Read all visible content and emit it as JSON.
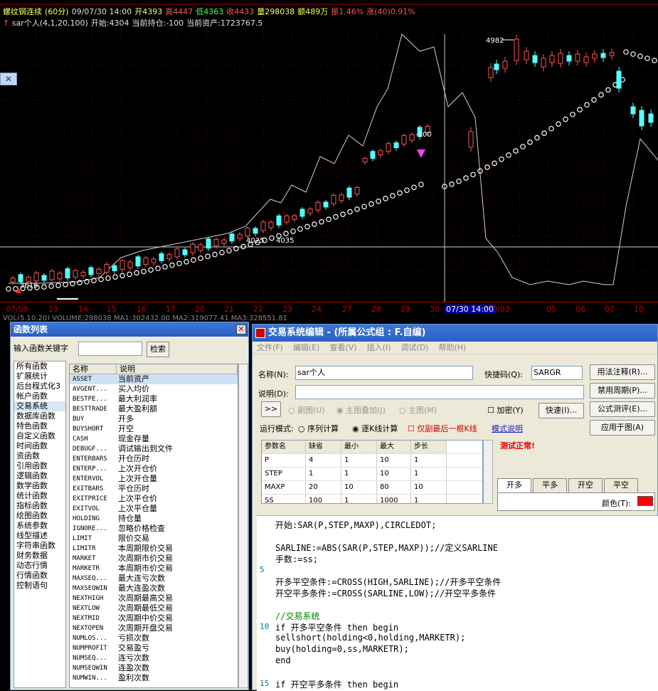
{
  "chart": {
    "symbol": "螺纹钢连续",
    "period": "(60分)",
    "datetime": "09/07/30 14:00",
    "open_label": "开4393",
    "high_label": "高4447",
    "low_label": "低4363",
    "close_label": "收4433",
    "volume_label": "量298038",
    "amount_label": "额489万",
    "amplitude_label": "振1.46%",
    "change_label": "涨(40)0.91%",
    "indicator": "sar个人(4,1,20,100)",
    "ind_start": "开始:4304",
    "ind_hold": "当前持仓:-100",
    "ind_asset": "当前资产:1723767.5",
    "price_peak": "4982",
    "price_mid": "4025",
    "price_mid2": "4035",
    "price_low": "3616",
    "signal_text": "-100",
    "vol_line": "VOL(5,10,20) VOLUME:298038 MA1:302432.00 MA2:319077.41 MA3:328551.81",
    "x_labels": [
      "07/09",
      "13",
      "14",
      "15",
      "16",
      "17",
      "20",
      "21",
      "22",
      "23",
      "24",
      "27",
      "28",
      "29",
      "30",
      "07/30 14:00",
      "0/03",
      "05",
      "06",
      "07",
      "10"
    ],
    "highlight_index": 15
  },
  "fn_window": {
    "title": "函数列表",
    "search_label": "输入函数关键字",
    "search_button": "检索",
    "categories": [
      "所有函数",
      "扩展统计",
      "后台程式化3",
      "帐户函数",
      "交易系统",
      "数据库函数",
      "特色函数",
      "自定义函数",
      "时间函数",
      "资函数",
      "引用函数",
      "逻辑函数",
      "数学函数",
      "统计函数",
      "指标函数",
      "绘图函数",
      "系统参数",
      "线型描述",
      "字符串函数",
      "财务数据",
      "动态行情",
      "行情函数",
      "控制语句"
    ],
    "selected_category": 4,
    "col_name": "名称",
    "col_desc": "说明",
    "functions": [
      [
        "ASSET",
        "当前资产"
      ],
      [
        "AVGENT...",
        "买入均价"
      ],
      [
        "BESTPE...",
        "最大利润率"
      ],
      [
        "BESTTRADE",
        "最大盈利额"
      ],
      [
        "BUY",
        "开多"
      ],
      [
        "BUYSHORT",
        "开空"
      ],
      [
        "CASH",
        "现金存量"
      ],
      [
        "DEBUGF...",
        "调试输出到文件"
      ],
      [
        "ENTERBARS",
        "开仓历时"
      ],
      [
        "ENTERP...",
        "上次开仓价"
      ],
      [
        "ENTERVOL",
        "上次开仓量"
      ],
      [
        "EXITBARS",
        "平仓历时"
      ],
      [
        "EXITPRICE",
        "上次平仓价"
      ],
      [
        "EXITVOL",
        "上次平仓量"
      ],
      [
        "HOLDING",
        "持仓量"
      ],
      [
        "IGNORE...",
        "忽略价格检查"
      ],
      [
        "LIMIT",
        "限价交易"
      ],
      [
        "LIMITR",
        "本周期限价交易"
      ],
      [
        "MARKET",
        "次周期市价交易"
      ],
      [
        "MARKETR",
        "本周期市价交易"
      ],
      [
        "MAXSEQ...",
        "最大连亏次数"
      ],
      [
        "MAXSEQWIN",
        "最大连盈次数"
      ],
      [
        "NEXTHIGH",
        "次周期最高交易"
      ],
      [
        "NEXTLOW",
        "次周期最低交易"
      ],
      [
        "NEXTMID",
        "次周期中价交易"
      ],
      [
        "NEXTOPEN",
        "次周期开盘交易"
      ],
      [
        "NUMLOS...",
        "亏损次数"
      ],
      [
        "NUMPROFIT",
        "交易盈亏"
      ],
      [
        "NUMSEQ...",
        "连亏次数"
      ],
      [
        "NUMSEQWIN",
        "连盈次数"
      ],
      [
        "NUMWIN...",
        "盈利次数"
      ]
    ]
  },
  "editor": {
    "title": "交易系统编辑 - (所属公式组 : F.自编)",
    "menu": [
      "文件(F)",
      "编辑(E)",
      "查看(V)",
      "插入(I)",
      "调试(D)",
      "帮助(H)"
    ],
    "name_label": "名称(N):",
    "name_value": "sar个人",
    "shortcut_label": "快捷码(Q):",
    "shortcut_value": "SARGR",
    "desc_label": "说明(D):",
    "btn_usage": "用法注释(R)...",
    "btn_period": "禁用周期(P)...",
    "btn_test": "公式测评(E)...",
    "btn_apply": "应用于图(A)",
    "btn_arrow": ">>",
    "radio_sub": "副图(U)",
    "radio_main_overlay": "主图叠加(J)",
    "radio_main": "主图(M)",
    "chk_encrypt": "加密(Y)",
    "btn_fast": "快速(I)...",
    "run_mode_label": "运行模式:",
    "opt_seq": "序列计算",
    "opt_tick": "逐K线计算",
    "opt_last": "仅副最后一根K线",
    "mode_help": "模式说明",
    "test_ok": "测试正常!",
    "params_head": [
      "参数名",
      "缺省",
      "最小",
      "最大",
      "步长"
    ],
    "params": [
      [
        "P",
        "4",
        "1",
        "10",
        "1"
      ],
      [
        "STEP",
        "1",
        "1",
        "10",
        "1"
      ],
      [
        "MAXP",
        "20",
        "10",
        "80",
        "10"
      ],
      [
        "SS",
        "100",
        "1",
        "1000",
        "1"
      ]
    ],
    "tabs": [
      "开多",
      "平多",
      "开空",
      "平空"
    ],
    "color_label": "颜色(T):",
    "code_lines": [
      {
        "n": "",
        "t": "开始:SAR(P,STEP,MAXP),CIRCLEDOT;"
      },
      {
        "n": "",
        "t": ""
      },
      {
        "n": "",
        "t": "SARLINE:=ABS(SAR(P,STEP,MAXP));//定义SARLINE"
      },
      {
        "n": "",
        "t": "手数:=ss;"
      },
      {
        "n": "5",
        "t": ""
      },
      {
        "n": "",
        "t": "开多平空条件:=CROSS(HIGH,SARLINE);//开多平空条件"
      },
      {
        "n": "",
        "t": "开空平多条件:=CROSS(SARLINE,LOW);//开空平多条件"
      },
      {
        "n": "",
        "t": ""
      },
      {
        "n": "",
        "t": "//交易系统"
      },
      {
        "n": "10",
        "t": "if 开多平空条件 then begin"
      },
      {
        "n": "",
        "t": "sellshort(holding<0,holding,MARKETR);"
      },
      {
        "n": "",
        "t": "buy(holding=0,ss,MARKETR);"
      },
      {
        "n": "",
        "t": "end"
      },
      {
        "n": "",
        "t": ""
      },
      {
        "n": "15",
        "t": "if 开空平多条件 then begin"
      }
    ]
  }
}
